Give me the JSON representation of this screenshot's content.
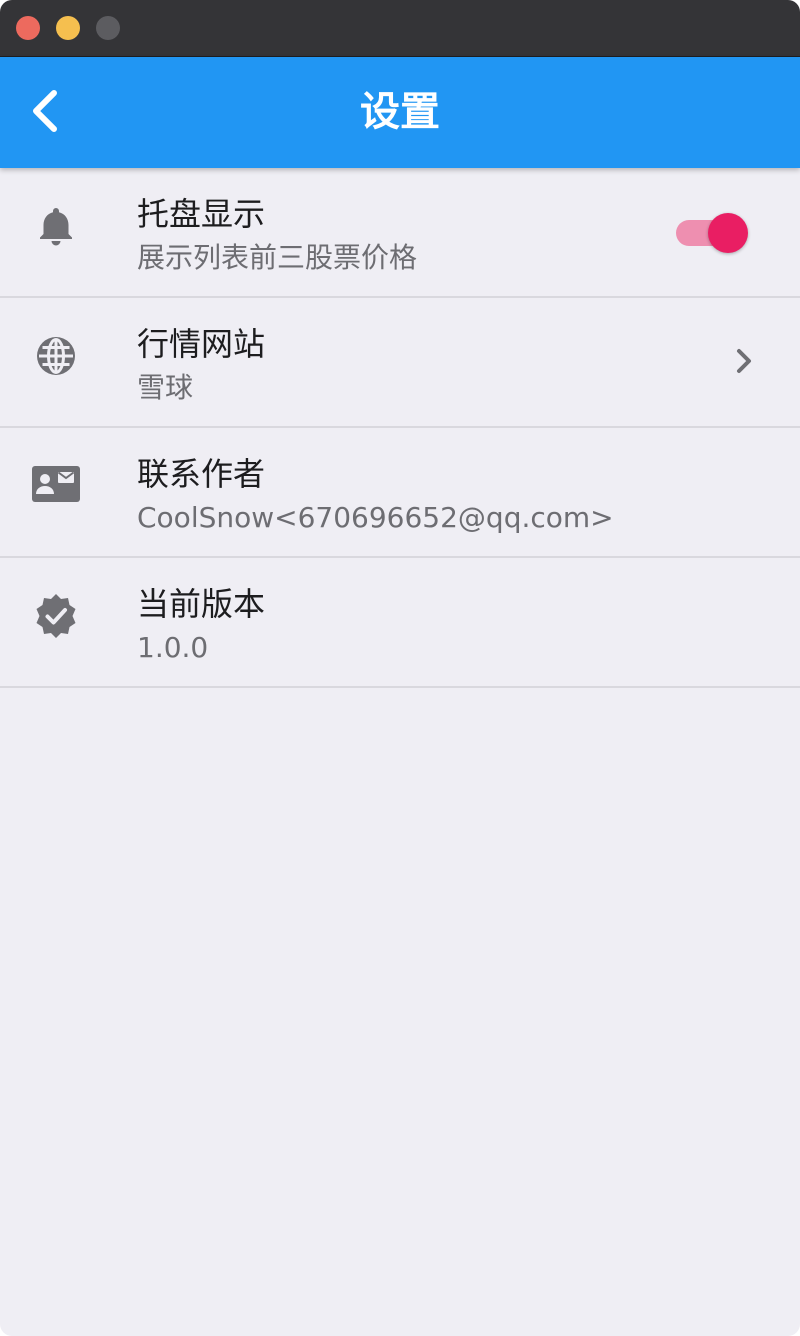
{
  "window": {
    "controls": [
      "close",
      "minimize",
      "maximize"
    ]
  },
  "appbar": {
    "title": "设置",
    "back_icon": "chevron-left-icon",
    "color": "#2196f3"
  },
  "settings": [
    {
      "icon": "bell-icon",
      "title": "托盘显示",
      "subtitle": "展示列表前三股票价格",
      "trailing": "toggle",
      "toggle_on": true
    },
    {
      "icon": "globe-icon",
      "title": "行情网站",
      "subtitle": "雪球",
      "trailing": "chevron-right-icon"
    },
    {
      "icon": "contact-mail-icon",
      "title": "联系作者",
      "subtitle": "CoolSnow<670696652@qq.com>"
    },
    {
      "icon": "verified-badge-icon",
      "title": "当前版本",
      "subtitle": "1.0.0"
    }
  ],
  "colors": {
    "accent": "#e91e63",
    "accent_track": "#ee8fb0",
    "background": "#efeef4"
  }
}
